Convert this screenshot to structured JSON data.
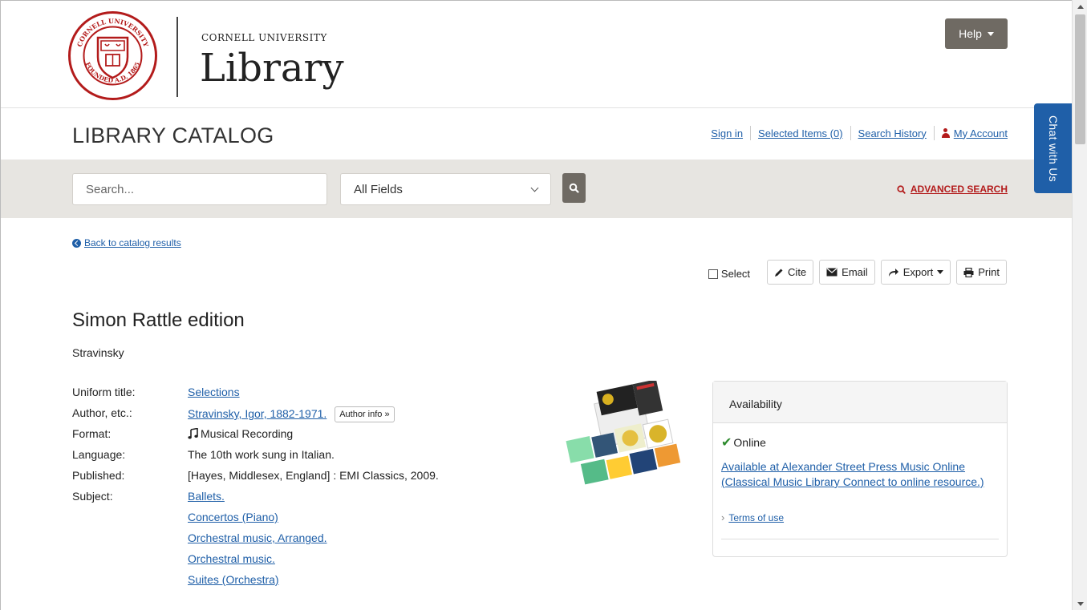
{
  "brand": {
    "university": "CORNELL UNIVERSITY",
    "name": "Library",
    "seal_text": "CORNELL UNIVERSITY · FOUNDED A.D. 1865"
  },
  "header": {
    "help_label": "Help",
    "catalog_title": "LIBRARY CATALOG",
    "links": {
      "sign_in": "Sign in",
      "selected_items": "Selected Items (0)",
      "search_history": "Search History",
      "my_account": "My Account"
    }
  },
  "search": {
    "placeholder": "Search...",
    "field": "All Fields",
    "advanced": "ADVANCED SEARCH"
  },
  "chat": {
    "label": "Chat with Us"
  },
  "nav": {
    "back": "Back to catalog results"
  },
  "tools": {
    "select": "Select",
    "cite": "Cite",
    "email": "Email",
    "export": "Export",
    "print": "Print"
  },
  "record": {
    "title": "Simon Rattle edition",
    "author": "Stravinsky",
    "uniform_title_label": "Uniform title:",
    "uniform_title": "Selections",
    "author_label": "Author, etc.:",
    "author_value": "Stravinsky, Igor, 1882-1971.",
    "author_info": "Author info »",
    "format_label": "Format:",
    "format": "Musical Recording",
    "language_label": "Language:",
    "language": "The 10th work sung in Italian.",
    "published_label": "Published:",
    "published": "[Hayes, Middlesex, England] : EMI Classics, 2009.",
    "subject_label": "Subject:",
    "subjects": [
      "Ballets.",
      "Concertos (Piano)",
      "Orchestral music, Arranged.",
      "Orchestral music.",
      "Suites (Orchestra)"
    ]
  },
  "availability": {
    "heading": "Availability",
    "status": "Online",
    "link": "Available at Alexander Street Press Music Online (Classical Music Library Connect to online resource.)",
    "terms": "Terms of use"
  },
  "colors": {
    "cornell_red": "#b31b1b",
    "link_blue": "#1f5fa8",
    "button_gray": "#6f6a63",
    "search_band": "#e7e5e1"
  }
}
